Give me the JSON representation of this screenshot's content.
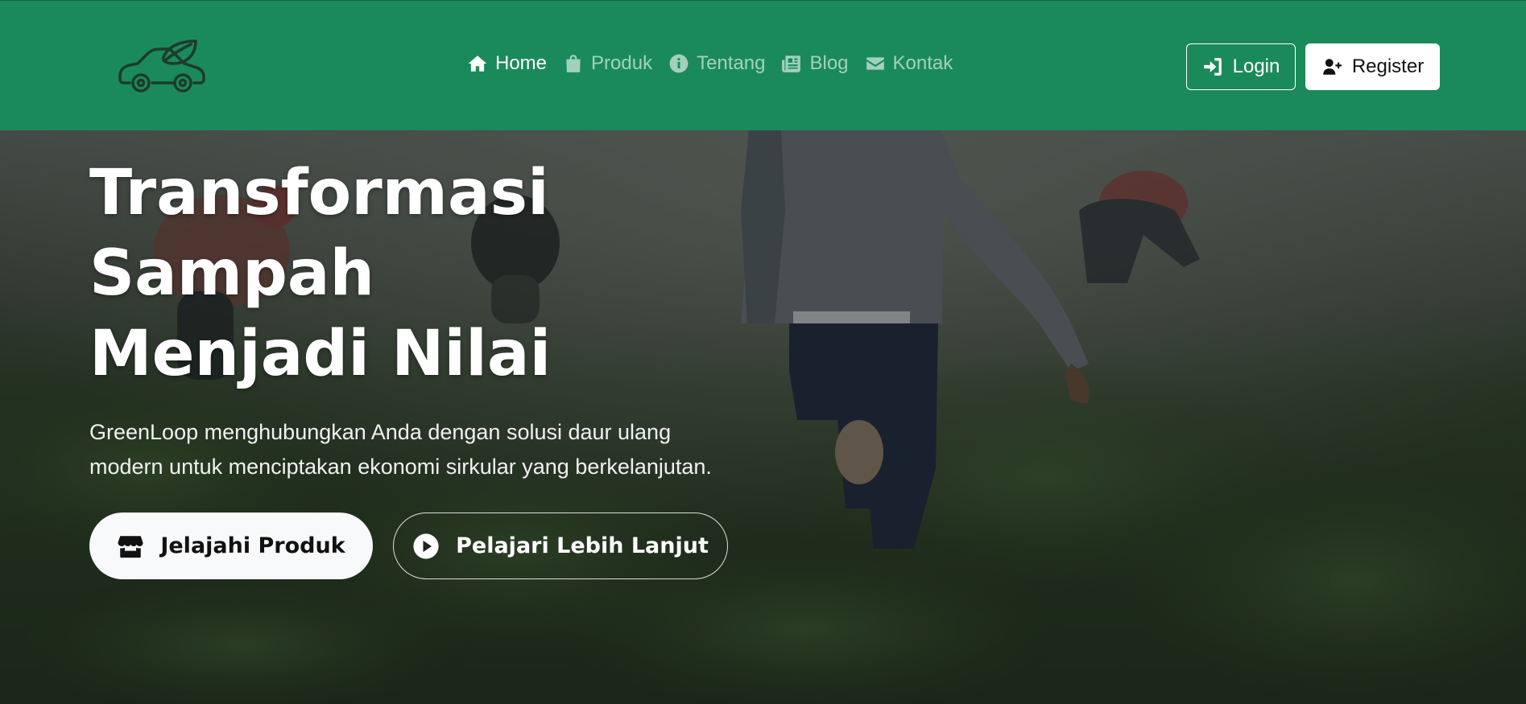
{
  "brand": {
    "logo_icon": "eco-car-icon"
  },
  "nav": {
    "items": [
      {
        "label": "Home",
        "icon": "home-icon",
        "active": true
      },
      {
        "label": "Produk",
        "icon": "shopping-bag-icon",
        "active": false
      },
      {
        "label": "Tentang",
        "icon": "info-circle-icon",
        "active": false
      },
      {
        "label": "Blog",
        "icon": "newspaper-icon",
        "active": false
      },
      {
        "label": "Kontak",
        "icon": "envelope-icon",
        "active": false
      }
    ],
    "login_label": "Login",
    "register_label": "Register"
  },
  "hero": {
    "title": "Transformasi Sampah Menjadi Nilai",
    "subtitle": "GreenLoop menghubungkan Anda dengan solusi daur ulang modern untuk menciptakan ekonomi sirkular yang berkelanjutan.",
    "primary_cta": "Jelajahi Produk",
    "secondary_cta": "Pelajari Lebih Lanjut"
  },
  "colors": {
    "navbar": "#1b8a5a",
    "hero_overlay": "#1f2d1c",
    "text_light": "#ffffff"
  }
}
